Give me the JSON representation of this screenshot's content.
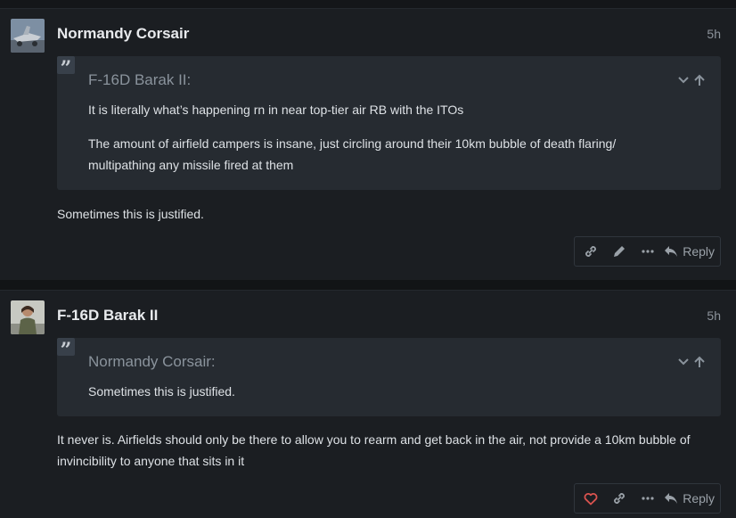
{
  "posts": [
    {
      "username": "Normandy Corsair",
      "time": "5h",
      "quote": {
        "author": "F-16D Barak II:",
        "lines": [
          "It is literally what’s happening rn in near top-tier air RB with the ITOs",
          "The amount of airfield campers is insane, just circling around their 10km bubble of death flaring/",
          "multipathing any missile fired at them"
        ]
      },
      "body": [
        "Sometimes this is justified."
      ],
      "actions": {
        "reply_label": "Reply",
        "icons": [
          "link-icon",
          "edit-icon",
          "more-icon",
          "reply-icon"
        ]
      }
    },
    {
      "username": "F-16D Barak II",
      "time": "5h",
      "quote": {
        "author": "Normandy Corsair:",
        "lines": [
          "Sometimes this is justified."
        ]
      },
      "body": [
        "It never is. Airfields should only be there to allow you to rearm and get back in the air, not provide a 10km bubble of",
        "invincibility to anyone that sits in it"
      ],
      "actions": {
        "reply_label": "Reply",
        "icons": [
          "like-heart-icon",
          "link-icon",
          "more-icon",
          "reply-icon"
        ]
      }
    }
  ],
  "colors": {
    "like": "#d9534f",
    "muted": "#9aa1a8"
  }
}
